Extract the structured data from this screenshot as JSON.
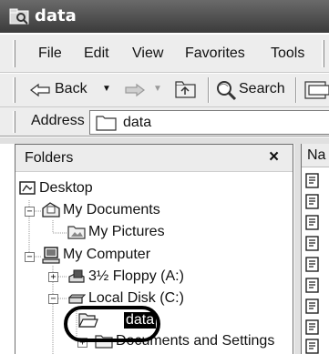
{
  "window": {
    "title": "data"
  },
  "menu": {
    "items": [
      "File",
      "Edit",
      "View",
      "Favorites",
      "Tools"
    ]
  },
  "toolbar": {
    "back_label": "Back",
    "search_label": "Search"
  },
  "address": {
    "label": "Address",
    "value": "data"
  },
  "folders_panel": {
    "title": "Folders",
    "close_glyph": "×",
    "tree": {
      "desktop": "Desktop",
      "my_documents": "My Documents",
      "my_pictures": "My Pictures",
      "my_computer": "My Computer",
      "floppy": "3½ Floppy (A:)",
      "local_disk": "Local Disk (C:)",
      "data": "data",
      "docs_settings": "Documents and Settings"
    }
  },
  "right_pane": {
    "column_header": "Na"
  },
  "colors": {
    "selection": "#000000",
    "title_bar": "#4a4a4a"
  }
}
